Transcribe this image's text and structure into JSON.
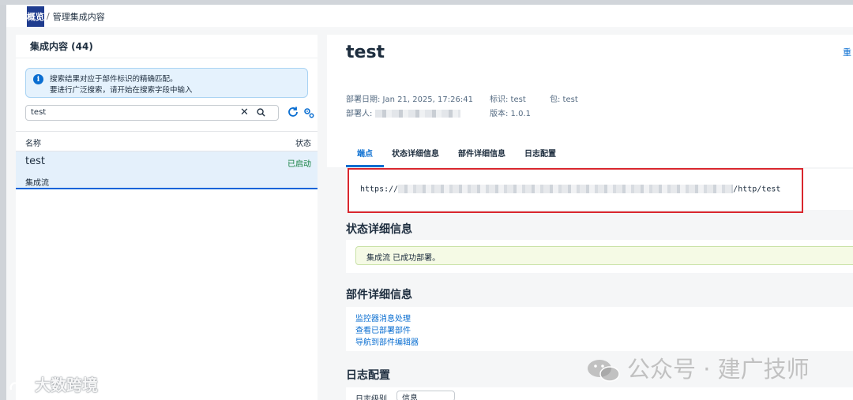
{
  "header": {
    "logo_text": "概览",
    "separator": "/",
    "breadcrumb": "管理集成内容"
  },
  "left_panel": {
    "title": "集成内容 (44)",
    "info_line1": "搜索结果对应于部件标识的精确匹配。",
    "info_line2": "要进行广泛搜索，请开始在搜索字段中输入",
    "search_value": "test",
    "columns": {
      "name": "名称",
      "status": "状态"
    },
    "rows": [
      {
        "name": "test",
        "status": "已启动",
        "type": "集成流"
      }
    ]
  },
  "detail": {
    "title": "test",
    "reset_label": "重",
    "deploy_date": "部署日期: Jan 21, 2025, 17:26:41",
    "identifier": "标识: test",
    "package": "包: test",
    "deployer_label": "部署人:",
    "version": "版本: 1.0.1",
    "tabs": [
      "端点",
      "状态详细信息",
      "部件详细信息",
      "日志配置"
    ],
    "endpoint_prefix": "https://",
    "endpoint_suffix": "/http/test",
    "status_section_title": "状态详细信息",
    "status_message": "集成流 已成功部署。",
    "component_section_title": "部件详细信息",
    "component_links": [
      "监控器消息处理",
      "查看已部署部件",
      "导航到部件编辑器"
    ],
    "log_section_title": "日志配置",
    "log_level_label": "日志级别",
    "log_level_value": "信息"
  },
  "watermarks": {
    "left": "大数跨境",
    "right": "公众号 · 建广技师"
  },
  "colors": {
    "accent": "#0a6ed1",
    "success": "#107e3e",
    "highlight_border": "#d9272e",
    "selection": "#e4f0fb"
  }
}
